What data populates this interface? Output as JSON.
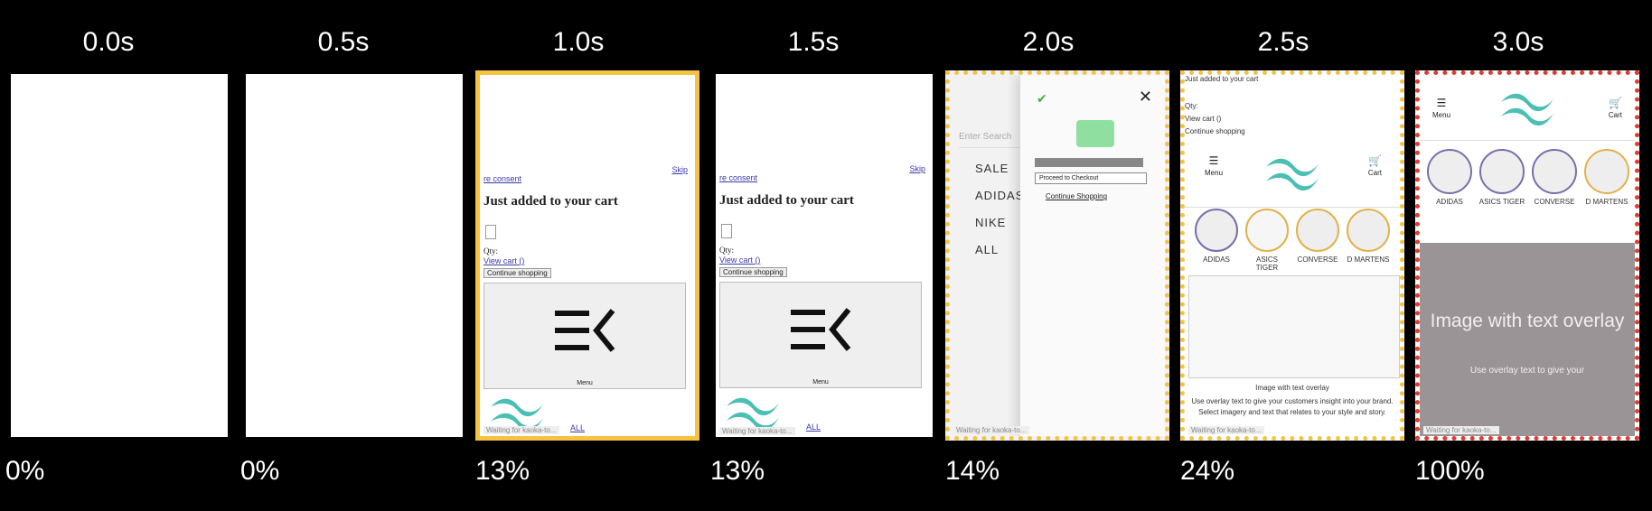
{
  "frames": [
    {
      "time": "0.0s",
      "percent": "0%"
    },
    {
      "time": "0.5s",
      "percent": "0%"
    },
    {
      "time": "1.0s",
      "percent": "13%"
    },
    {
      "time": "1.5s",
      "percent": "13%"
    },
    {
      "time": "2.0s",
      "percent": "14%"
    },
    {
      "time": "2.5s",
      "percent": "24%"
    },
    {
      "time": "3.0s",
      "percent": "100%"
    }
  ],
  "page": {
    "consent_link": "re consent",
    "skip_link": "Skip",
    "cart_title": "Just added to your cart",
    "qty_label": "Qty:",
    "view_cart": "View cart ()",
    "continue_shopping": "Continue shopping",
    "menu_label": "Menu",
    "cart_label": "Cart",
    "all_link": "ALL",
    "waiting_status": "Waiting for kaoka-to...",
    "search_placeholder": "Enter Search",
    "nav_items": [
      "SALE",
      "ADIDAS",
      "NIKE",
      "ALL"
    ],
    "proceed_checkout": "Proceed to Checkout",
    "continue_shopping_link": "Continue Shopping",
    "brands": [
      "ADIDAS",
      "ASICS TIGER",
      "CONVERSE",
      "D MARTENS"
    ],
    "overlay_title": "Image with text overlay",
    "overlay_body": "Use overlay text to give your customers insight into your brand. Select imagery and text that relates to your style and story.",
    "overlay_body_short": "Use overlay text to give your"
  }
}
